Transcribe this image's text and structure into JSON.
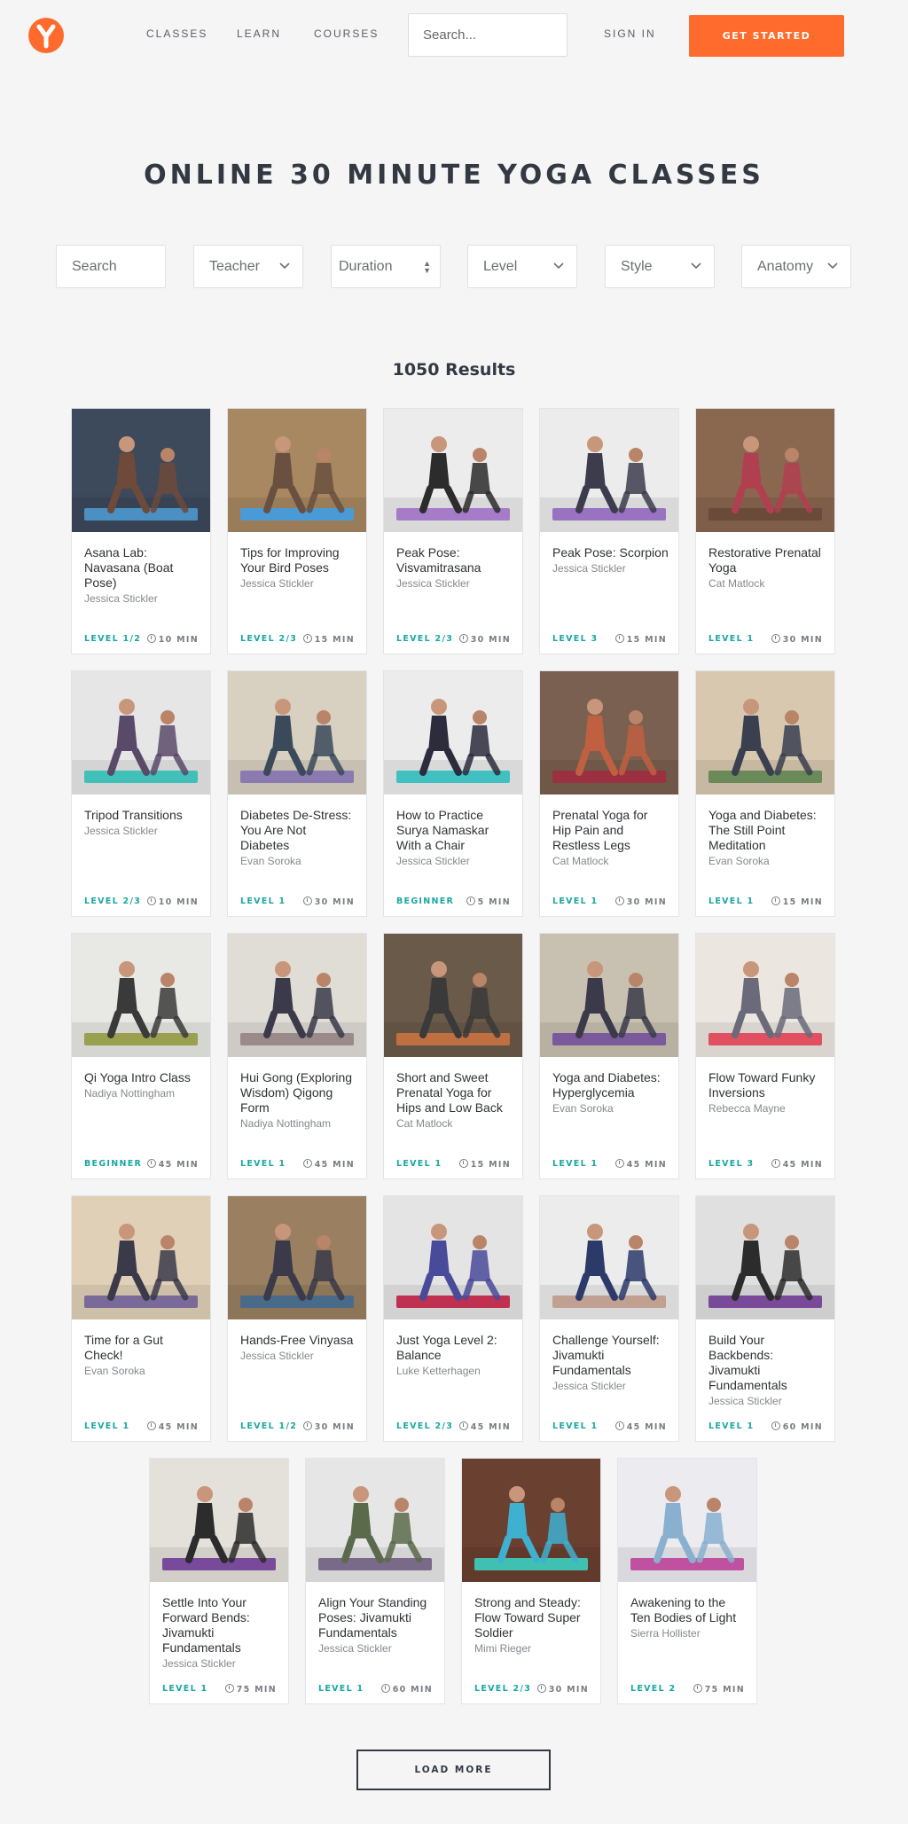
{
  "nav": {
    "logo_icon": "yoga-logo-icon",
    "links": [
      "CLASSES",
      "LEARN",
      "COURSES"
    ],
    "search_placeholder": "Search...",
    "sign_in": "SIGN IN",
    "cta": "GET STARTED"
  },
  "page_title": "ONLINE 30 MINUTE YOGA CLASSES",
  "filters": {
    "search_placeholder": "Search",
    "teacher": "Teacher",
    "duration": "Duration",
    "level": "Level",
    "style": "Style",
    "anatomy": "Anatomy"
  },
  "results_label": "1050 Results",
  "colors": {
    "accent": "#ff6b2c",
    "level": "#1aa7a0",
    "text": "#333943"
  },
  "cards": [
    {
      "title": "Asana Lab: Navasana (Boat Pose)",
      "teacher": "Jessica Stickler",
      "level": "LEVEL 1/2",
      "duration": "10 MIN",
      "palette": [
        "#3c4a5c",
        "#6e4a3a",
        "#4a90c2"
      ]
    },
    {
      "title": "Tips for Improving Your Bird Poses",
      "teacher": "Jessica Stickler",
      "level": "LEVEL 2/3",
      "duration": "15 MIN",
      "palette": [
        "#a88860",
        "#6a5040",
        "#4a9ad6"
      ]
    },
    {
      "title": "Peak Pose: Visvamitrasana",
      "teacher": "Jessica Stickler",
      "level": "LEVEL 2/3",
      "duration": "30 MIN",
      "palette": [
        "#ececec",
        "#2c2c2c",
        "#a67cc8"
      ]
    },
    {
      "title": "Peak Pose: Scorpion",
      "teacher": "Jessica Stickler",
      "level": "LEVEL 3",
      "duration": "15 MIN",
      "palette": [
        "#ececec",
        "#3c3c4c",
        "#9a72c2"
      ]
    },
    {
      "title": "Restorative Prenatal Yoga",
      "teacher": "Cat Matlock",
      "level": "LEVEL 1",
      "duration": "30 MIN",
      "palette": [
        "#8a6850",
        "#b04050",
        "#6a4a3a"
      ]
    },
    {
      "title": "Tripod Transitions",
      "teacher": "Jessica Stickler",
      "level": "LEVEL 2/3",
      "duration": "10 MIN",
      "palette": [
        "#e6e6e6",
        "#5a4a6a",
        "#40c0b8"
      ]
    },
    {
      "title": "Diabetes De-Stress: You Are Not Diabetes",
      "teacher": "Evan Soroka",
      "level": "LEVEL 1",
      "duration": "30 MIN",
      "palette": [
        "#d8d0c0",
        "#3a4a5a",
        "#8a7ab0"
      ]
    },
    {
      "title": "How to Practice Surya Namaskar With a Chair",
      "teacher": "Jessica Stickler",
      "level": "BEGINNER",
      "duration": "5 MIN",
      "palette": [
        "#ececec",
        "#2c2c3c",
        "#40c0c0"
      ]
    },
    {
      "title": "Prenatal Yoga for Hip Pain and Restless Legs",
      "teacher": "Cat Matlock",
      "level": "LEVEL 1",
      "duration": "30 MIN",
      "palette": [
        "#7a6050",
        "#c06040",
        "#9a3040"
      ]
    },
    {
      "title": "Yoga and Diabetes: The Still Point Meditation",
      "teacher": "Evan Soroka",
      "level": "LEVEL 1",
      "duration": "15 MIN",
      "palette": [
        "#d8c8b0",
        "#3a4050",
        "#6a8a5a"
      ]
    },
    {
      "title": "Qi Yoga Intro Class",
      "teacher": "Nadiya Nottingham",
      "level": "BEGINNER",
      "duration": "45 MIN",
      "palette": [
        "#e8e8e4",
        "#3a3a3a",
        "#9aa050"
      ]
    },
    {
      "title": "Hui Gong (Exploring Wisdom) Qigong Form",
      "teacher": "Nadiya Nottingham",
      "level": "LEVEL 1",
      "duration": "45 MIN",
      "palette": [
        "#e0dcd6",
        "#3a3a4a",
        "#9a8a8a"
      ]
    },
    {
      "title": "Short and Sweet Prenatal Yoga for Hips and Low Back",
      "teacher": "Cat Matlock",
      "level": "LEVEL 1",
      "duration": "15 MIN",
      "palette": [
        "#6a5a4a",
        "#3a3a3a",
        "#c07040"
      ]
    },
    {
      "title": "Yoga and Diabetes: Hyperglycemia",
      "teacher": "Evan Soroka",
      "level": "LEVEL 1",
      "duration": "45 MIN",
      "palette": [
        "#c8c0b0",
        "#3a3a4a",
        "#7a5a9a"
      ]
    },
    {
      "title": "Flow Toward Funky Inversions",
      "teacher": "Rebecca Mayne",
      "level": "LEVEL 3",
      "duration": "45 MIN",
      "palette": [
        "#ece6e0",
        "#6a6a7a",
        "#e05060"
      ]
    },
    {
      "title": "Time for a Gut Check!",
      "teacher": "Evan Soroka",
      "level": "LEVEL 1",
      "duration": "45 MIN",
      "palette": [
        "#e0d0b8",
        "#3a3a4a",
        "#7a6a9a"
      ]
    },
    {
      "title": "Hands-Free Vinyasa",
      "teacher": "Jessica Stickler",
      "level": "LEVEL 1/2",
      "duration": "30 MIN",
      "palette": [
        "#9a8060",
        "#3a3a4a",
        "#4a6a8a"
      ]
    },
    {
      "title": "Just Yoga Level 2: Balance",
      "teacher": "Luke Ketterhagen",
      "level": "LEVEL 2/3",
      "duration": "45 MIN",
      "palette": [
        "#e4e4e4",
        "#4a4a9a",
        "#c03050"
      ]
    },
    {
      "title": "Challenge Yourself: Jivamukti Fundamentals",
      "teacher": "Jessica Stickler",
      "level": "LEVEL 1",
      "duration": "45 MIN",
      "palette": [
        "#ececec",
        "#2c3a6a",
        "#c0a090"
      ]
    },
    {
      "title": "Build Your Backbends: Jivamukti Fundamentals",
      "teacher": "Jessica Stickler",
      "level": "LEVEL 1",
      "duration": "60 MIN",
      "palette": [
        "#e0e0e0",
        "#2c2c2c",
        "#7a4a9a"
      ]
    },
    {
      "title": "Settle Into Your Forward Bends: Jivamukti Fundamentals",
      "teacher": "Jessica Stickler",
      "level": "LEVEL 1",
      "duration": "75 MIN",
      "palette": [
        "#e4e0da",
        "#2c2c2c",
        "#7a4a9a"
      ]
    },
    {
      "title": "Align Your Standing Poses: Jivamukti Fundamentals",
      "teacher": "Jessica Stickler",
      "level": "LEVEL 1",
      "duration": "60 MIN",
      "palette": [
        "#e6e6e6",
        "#5a6a4a",
        "#7a6a8a"
      ]
    },
    {
      "title": "Strong and Steady: Flow Toward Super Soldier",
      "teacher": "Mimi Rieger",
      "level": "LEVEL 2/3",
      "duration": "30 MIN",
      "palette": [
        "#6a4030",
        "#40b0d0",
        "#40c0b0"
      ]
    },
    {
      "title": "Awakening to the Ten Bodies of Light",
      "teacher": "Sierra Hollister",
      "level": "LEVEL 2",
      "duration": "75 MIN",
      "palette": [
        "#ececf0",
        "#8ab0d0",
        "#c050a0"
      ]
    }
  ],
  "load_more": "LOAD MORE"
}
